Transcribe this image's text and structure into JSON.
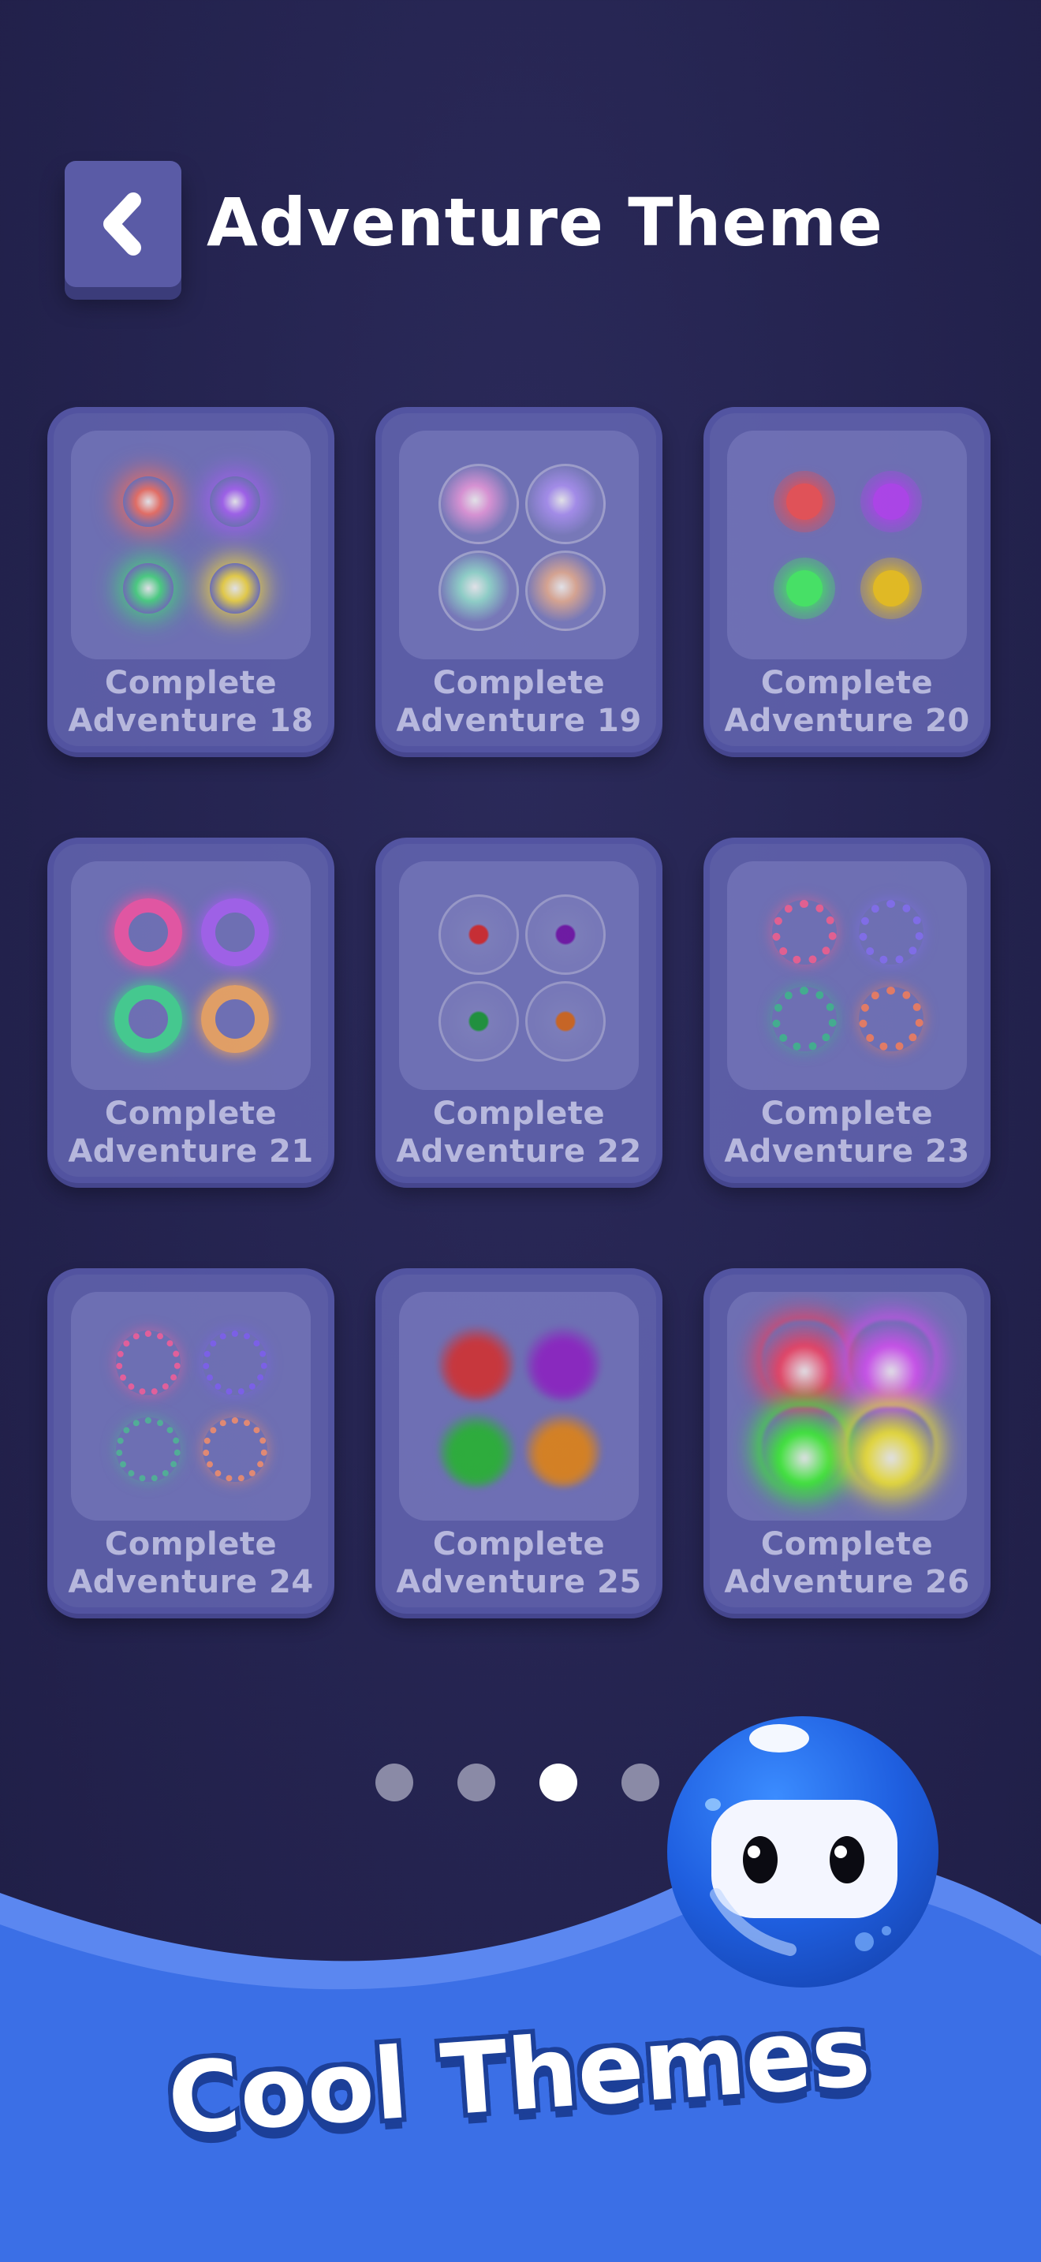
{
  "header": {
    "title": "Adventure Theme",
    "back_icon": "chevron-left-icon"
  },
  "themes": [
    {
      "label": "Complete Adventure 18",
      "style": "sparkle",
      "colors": [
        "#ff7a6a",
        "#b06bff",
        "#52e38a",
        "#ffe34a"
      ]
    },
    {
      "label": "Complete Adventure 19",
      "style": "bubble",
      "colors": [
        "#f2a3e6",
        "#b69cff",
        "#9fe7d8",
        "#f0b79b"
      ]
    },
    {
      "label": "Complete Adventure 20",
      "style": "ring-dot",
      "colors": [
        "#ff5a5a",
        "#c14bff",
        "#4dff6a",
        "#ffd21e"
      ]
    },
    {
      "label": "Complete Adventure 21",
      "style": "donut",
      "colors": [
        "#ff5fb0",
        "#b26bff",
        "#4be39a",
        "#ffb36a"
      ]
    },
    {
      "label": "Complete Adventure 22",
      "style": "glass-seed",
      "colors": [
        "#e03030",
        "#7a1ab0",
        "#20a23c",
        "#e0701e"
      ]
    },
    {
      "label": "Complete Adventure 23",
      "style": "spark-ring",
      "colors": [
        "#ff6a9c",
        "#8f7aff",
        "#4ac39a",
        "#ff8a6a"
      ]
    },
    {
      "label": "Complete Adventure 24",
      "style": "thin-ring",
      "colors": [
        "#ff6aa8",
        "#8a6aff",
        "#5ac3a4",
        "#ff9a7a"
      ]
    },
    {
      "label": "Complete Adventure 25",
      "style": "flame",
      "colors": [
        "#e23a3a",
        "#9a2ad0",
        "#30c23a",
        "#f0901e"
      ]
    },
    {
      "label": "Complete Adventure 26",
      "style": "big-flame",
      "colors": [
        "#ff4a6a",
        "#e05aff",
        "#45ff3a",
        "#fff23a"
      ]
    }
  ],
  "pagination": {
    "pages": 4,
    "current": 3
  },
  "banner": {
    "text": "Cool Themes"
  },
  "mascot": {
    "icon": "blue-blob-mascot-icon"
  }
}
